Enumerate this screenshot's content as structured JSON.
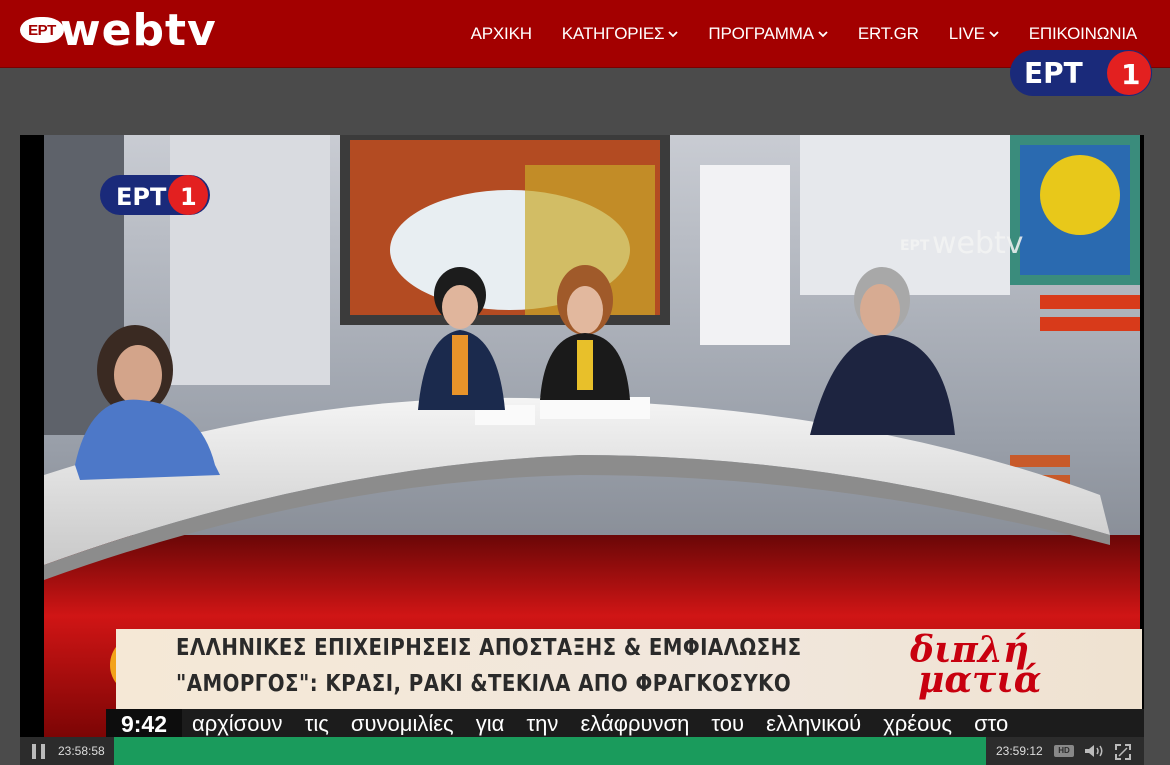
{
  "header": {
    "logo_badge": "ΕΡΤ",
    "logo_text": "webtv",
    "nav": [
      {
        "label": "ΑΡΧΙΚΗ",
        "dropdown": false
      },
      {
        "label": "ΚΑΤΗΓΟΡΙΕΣ",
        "dropdown": true
      },
      {
        "label": "ΠΡΟΓΡΑΜΜΑ",
        "dropdown": true
      },
      {
        "label": "ERT.GR",
        "dropdown": false
      },
      {
        "label": "LIVE",
        "dropdown": true
      },
      {
        "label": "ΕΠΙΚΟΙΝΩΝΙΑ",
        "dropdown": false
      }
    ],
    "channel_logo": "ΕΡΤ 1"
  },
  "video": {
    "channel_watermark": "ΕΡΤ 1",
    "studio_watermark": "ΕΡΤ webtv",
    "lower_third": {
      "line1": "ΕΛΛΗΝΙΚΕΣ ΕΠΙΧΕΙΡΗΣΕΙΣ ΑΠΟΣΤΑΞΗΣ & ΕΜΦΙΑΛΩΣΗΣ",
      "line2": "\"ΑΜΟΡΓΟΣ\": ΚΡΑΣΙ, ΡΑΚΙ &ΤΕΚΙΛΑ ΑΠΟ ΦΡΑΓΚΟΣΥΚΟ"
    },
    "show_logo": [
      "διπλή",
      "ματιά"
    ],
    "ticker": {
      "time": "9:42",
      "text": "αρχίσουν τις συνομιλίες για την ελάφρυνση του ελληνικού χρέους στο"
    }
  },
  "controls": {
    "elapsed": "23:58:58",
    "duration": "23:59:12",
    "progress_fraction": 1.0,
    "hd_label": "HD",
    "icons": [
      "pause-icon",
      "hd-icon",
      "volume-icon",
      "fullscreen-icon"
    ]
  },
  "colors": {
    "header_bg": "#a30000",
    "page_bg": "#4b4b4b",
    "progress": "#1a9b5c"
  }
}
